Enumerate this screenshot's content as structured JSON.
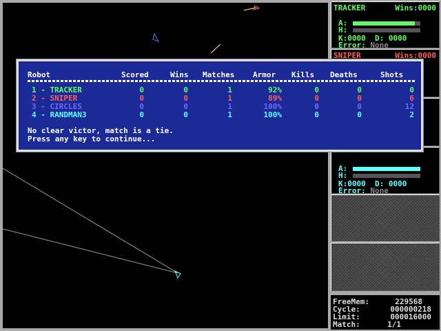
{
  "arena": {
    "background": "#000000"
  },
  "robots": [
    {
      "id": "tracker",
      "name": "TRACKER",
      "color": "#5cff5c",
      "wins_label": "Wins:",
      "wins": "0000",
      "armor_label": "A:",
      "heat_label": "H:",
      "armor_pct": 92,
      "heat_pct": 0,
      "kills_label": "K:",
      "kills": "0000",
      "deaths_label": "D:",
      "deaths": "0000",
      "error_label": "Error:",
      "error": "None"
    },
    {
      "id": "sniper",
      "name": "SNIPER",
      "color": "#ff5c5c",
      "wins_label": "Wins:",
      "wins": "0000",
      "armor_pct": 89
    },
    {
      "id": "randman3",
      "color": "#5cffff",
      "armor_label": "A:",
      "heat_label": "H:",
      "armor_pct": 100,
      "heat_pct": 0,
      "kills_label": "K:",
      "kills": "0000",
      "deaths_label": "D:",
      "deaths": "0000",
      "error_label": "Error:",
      "error": "None"
    }
  ],
  "status": {
    "freemem_label": "FreeMem:",
    "freemem": "229568",
    "cycle_label": "Cycle:",
    "cycle": "000000218",
    "limit_label": "Limit:",
    "limit": "000016000",
    "match_label": "Match:",
    "match": "1/1"
  },
  "results": {
    "headers": [
      "Robot",
      "Scored",
      "Wins",
      "Matches",
      "Armor",
      "Kills",
      "Deaths",
      "Shots"
    ],
    "rows": [
      {
        "entry": "1 - TRACKER",
        "scored": "0",
        "wins": "0",
        "matches": "1",
        "armor": "92%",
        "kills": "0",
        "deaths": "0",
        "shots": "0",
        "color": "#5cff5c"
      },
      {
        "entry": "2 - SNIPER",
        "scored": "0",
        "wins": "0",
        "matches": "1",
        "armor": "89%",
        "kills": "0",
        "deaths": "0",
        "shots": "6",
        "color": "#ff5c5c"
      },
      {
        "entry": "3 - CIRCLES",
        "scored": "0",
        "wins": "0",
        "matches": "1",
        "armor": "100%",
        "kills": "0",
        "deaths": "0",
        "shots": "12",
        "color": "#6a6aff"
      },
      {
        "entry": "4 - RANDMAN3",
        "scored": "0",
        "wins": "0",
        "matches": "1",
        "armor": "100%",
        "kills": "0",
        "deaths": "0",
        "shots": "2",
        "color": "#5cffff"
      }
    ],
    "message1": "No clear victor, match is a tie.",
    "message2": "Press any key to continue..."
  }
}
